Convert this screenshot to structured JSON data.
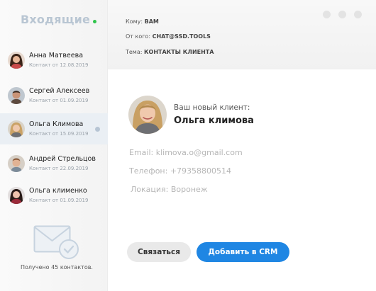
{
  "sidebar": {
    "title": "Входящие",
    "online_color": "#2ec44a",
    "contacts": [
      {
        "name": "Анна Матвеева",
        "meta": "Контакт от 12.08.2019",
        "active": false
      },
      {
        "name": "Сергей Алексеев",
        "meta": "Контакт от 01.09.2019",
        "active": false
      },
      {
        "name": "Ольга Климова",
        "meta": "Контакт от 15.09.2019",
        "active": true
      },
      {
        "name": "Андрей Стрельцов",
        "meta": "Контакт от 22.09.2019",
        "active": false
      },
      {
        "name": "Ольга клименко",
        "meta": "Контакт от 01.09.2019",
        "active": false
      }
    ],
    "footer_icon": "envelope-check-icon",
    "footer_text": "Получено 45  контактов."
  },
  "header": {
    "to_label": "Кому:",
    "to_value": "ВАМ",
    "from_label": "От кого:",
    "from_value": "CHAT@SSD.TOOLS",
    "subject_label": "Тема:",
    "subject_value": "КОНТАКТЫ КЛИЕНТА"
  },
  "detail": {
    "label": "Ваш новый клиент:",
    "name": "Ольга климова",
    "email": "Email: klimova.o@gmail.com",
    "phone": "Телефон: +79358800514",
    "location": "Локация: Воронеж"
  },
  "actions": {
    "contact_label": "Связаться",
    "crm_label": "Добавить в CRM",
    "accent_color": "#1f86e3"
  }
}
